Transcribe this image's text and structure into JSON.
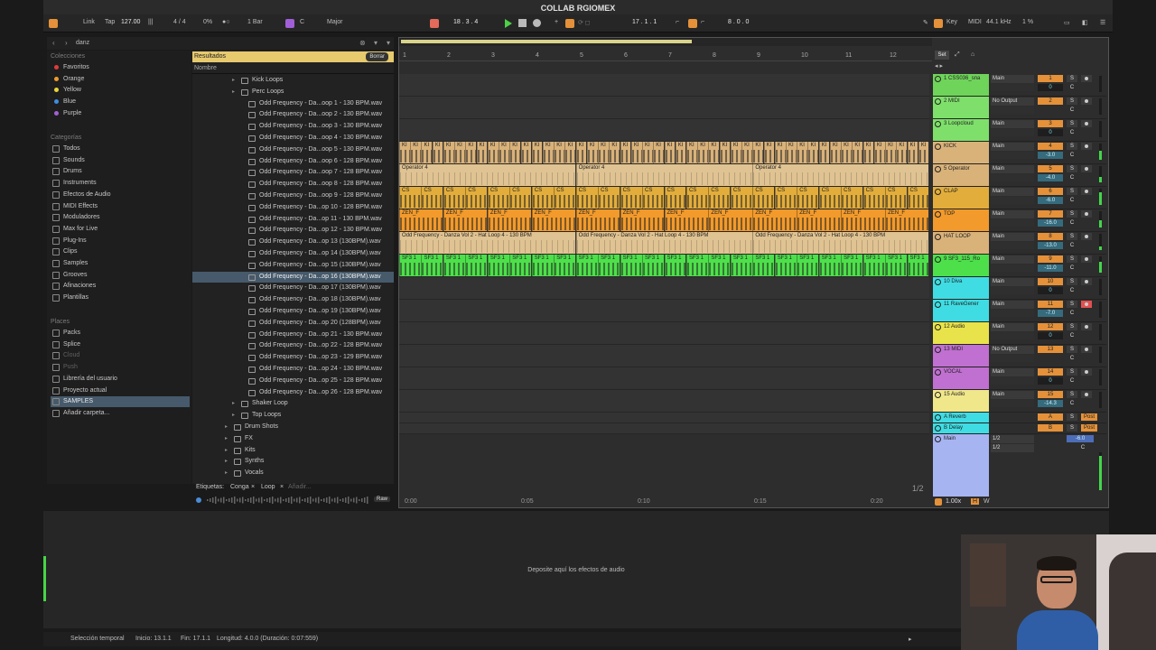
{
  "window": {
    "title": "COLLAB RGIOMEX"
  },
  "controlbar": {
    "link": "Link",
    "tap": "Tap",
    "tempo": "127.00",
    "signature": "4 / 4",
    "cpu": "0%",
    "quantize": "1 Bar",
    "key": "C",
    "scale": "Major",
    "position": "18 .  3 .  4",
    "loop_start": "17 .  1 .  1",
    "loop_length": "8 .  0 .  0",
    "key_btn": "Key",
    "midi_btn": "MIDI",
    "sample_rate": "44.1 kHz",
    "zoom": "1 %"
  },
  "browser": {
    "search_value": "danz",
    "sidebar": {
      "collections_header": "Colecciones",
      "collections": [
        {
          "label": "Favoritos",
          "color": "#e23b3b"
        },
        {
          "label": "Orange",
          "color": "#f09a2c"
        },
        {
          "label": "Yellow",
          "color": "#e8d53b"
        },
        {
          "label": "Blue",
          "color": "#3d8ee3"
        },
        {
          "label": "Purple",
          "color": "#a45fd6"
        }
      ],
      "categories_header": "Categorías",
      "categories": [
        "Todos",
        "Sounds",
        "Drums",
        "Instruments",
        "Efectos de Audio",
        "MIDI Effects",
        "Moduladores",
        "Max for Live",
        "Plug-Ins",
        "Clips",
        "Samples",
        "Grooves",
        "Afinaciones",
        "Plantillas"
      ],
      "places_header": "Places",
      "places": [
        "Packs",
        "Splice",
        "Cloud",
        "Push",
        "Librería del usuario",
        "Proyecto actual",
        "SAMPLES",
        "Añadir carpeta..."
      ]
    },
    "results_label": "Resultados",
    "clear_label": "Borrar",
    "name_col": "Nombre",
    "folders_top": [
      "Kick Loops",
      "Perc Loops"
    ],
    "files": [
      "Odd Frequency - Da...oop 1 - 130 BPM.wav",
      "Odd Frequency - Da...oop 2 - 130 BPM.wav",
      "Odd Frequency - Da...oop 3 - 130 BPM.wav",
      "Odd Frequency - Da...oop 4 - 130 BPM.wav",
      "Odd Frequency - Da...oop 5 - 130 BPM.wav",
      "Odd Frequency - Da...oop 6 - 128 BPM.wav",
      "Odd Frequency - Da...oop 7 - 128 BPM.wav",
      "Odd Frequency - Da...oop 8 - 128 BPM.wav",
      "Odd Frequency - Da...oop 9 - 128 BPM.wav",
      "Odd Frequency - Da...op 10 - 128 BPM.wav",
      "Odd Frequency - Da...op 11 - 130 BPM.wav",
      "Odd Frequency - Da...op 12 - 130 BPM.wav",
      "Odd Frequency - Da...op 13 (130BPM).wav",
      "Odd Frequency - Da...op 14 (130BPM).wav",
      "Odd Frequency - Da...op 15 (130BPM).wav",
      "Odd Frequency - Da...op 16 (130BPM).wav",
      "Odd Frequency - Da...op 17 (130BPM).wav",
      "Odd Frequency - Da...op 18 (130BPM).wav",
      "Odd Frequency - Da...op 19 (130BPM).wav",
      "Odd Frequency - Da...op 20 (128BPM).wav",
      "Odd Frequency - Da...op 21 - 130 BPM.wav",
      "Odd Frequency - Da...op 22 - 128 BPM.wav",
      "Odd Frequency - Da...op 23 - 129 BPM.wav",
      "Odd Frequency - Da...op 24 - 130 BPM.wav",
      "Odd Frequency - Da...op 25 - 128 BPM.wav",
      "Odd Frequency - Da...op 26 - 128 BPM.wav"
    ],
    "folders_bottom": [
      "Shaker Loop",
      "Top Loops",
      "Drum Shots",
      "FX",
      "Kits",
      "Synths",
      "Vocals"
    ],
    "tags_label": "Etiquetas:",
    "tags": [
      "Conga",
      "Loop"
    ],
    "add_tag": "Añadir...",
    "raw_label": "Raw"
  },
  "arrangement": {
    "ruler": [
      "1",
      "2",
      "3",
      "4",
      "5",
      "6",
      "7",
      "8",
      "9",
      "10",
      "11",
      "12"
    ],
    "time_labels": [
      "0:00",
      "0:05",
      "0:10",
      "0:15",
      "0:20"
    ],
    "fraction": "1/2",
    "clips": {
      "kick_label": "KI",
      "operator_label": "Operator 4",
      "clap_label": "CS",
      "top_label": "ZEN_F",
      "hat_label": "Odd Frequency - Danza Vol 2 - Hat Loop 4 - 130 BPM",
      "ro_label": "SF3 1"
    }
  },
  "mixer": {
    "set_label": "Set",
    "tracks": [
      {
        "name": "1 CSS036_sna",
        "color": "#6fd45a",
        "route": "Main",
        "num": "1",
        "vol": "0"
      },
      {
        "name": "2 MIDI",
        "color": "#7ee06a",
        "route": "No Output",
        "num": "2",
        "vol": ""
      },
      {
        "name": "3 Loopcloud",
        "color": "#7ee06a",
        "route": "Main",
        "num": "3",
        "vol": "0"
      },
      {
        "name": "KICK",
        "color": "#d9b27a",
        "route": "Main",
        "num": "4",
        "vol": "-3.0"
      },
      {
        "name": "5 Operator",
        "color": "#d9b27a",
        "route": "Main",
        "num": "5",
        "vol": "-4.0"
      },
      {
        "name": "CLAP",
        "color": "#e2ad3b",
        "route": "Main",
        "num": "6",
        "vol": "-6.0"
      },
      {
        "name": "TOP",
        "color": "#f29a2b",
        "route": "Main",
        "num": "7",
        "vol": "-16.0"
      },
      {
        "name": "HAT LOOP",
        "color": "#d9b27a",
        "route": "Main",
        "num": "8",
        "vol": "-13.0"
      },
      {
        "name": "9 SF3_115_Ro",
        "color": "#4de04a",
        "route": "Main",
        "num": "9",
        "vol": "-11.0"
      },
      {
        "name": "10 Diva",
        "color": "#3fdde3",
        "route": "Main",
        "num": "10",
        "vol": "0"
      },
      {
        "name": "11 RaveGener",
        "color": "#3fdde3",
        "route": "Main",
        "num": "11",
        "vol": "-7.0"
      },
      {
        "name": "12 Audio",
        "color": "#e8e34a",
        "route": "Main",
        "num": "12",
        "vol": "0"
      },
      {
        "name": "13 MIDI",
        "color": "#c070d0",
        "route": "No Output",
        "num": "13",
        "vol": ""
      },
      {
        "name": "VOCAL",
        "color": "#c070d0",
        "route": "Main",
        "num": "14",
        "vol": "0"
      },
      {
        "name": "15 Audio",
        "color": "#f0e68a",
        "route": "Main",
        "num": "15",
        "vol": "-14.3"
      }
    ],
    "returns": [
      {
        "name": "A Reverb",
        "color": "#3fdde3",
        "num": "A",
        "post": "Post"
      },
      {
        "name": "B Delay",
        "color": "#3fdde3",
        "num": "B",
        "post": "Post"
      }
    ],
    "main": {
      "name": "Main",
      "color": "#a7b4f2",
      "cue": "1/2",
      "cue2": "1/2",
      "vol": "-6.0"
    },
    "foot_zoom": "1.00x",
    "foot_h": "H",
    "foot_w": "W",
    "solo": "S",
    "center": "C"
  },
  "device": {
    "drop_text": "Deposite aquí los efectos de audio"
  },
  "status": {
    "mode": "Selección temporal",
    "start": "Inicio: 13.1.1",
    "end": "Fin: 17.1.1",
    "length": "Longitud: 4.0.0 (Duración: 0:07:559)"
  }
}
